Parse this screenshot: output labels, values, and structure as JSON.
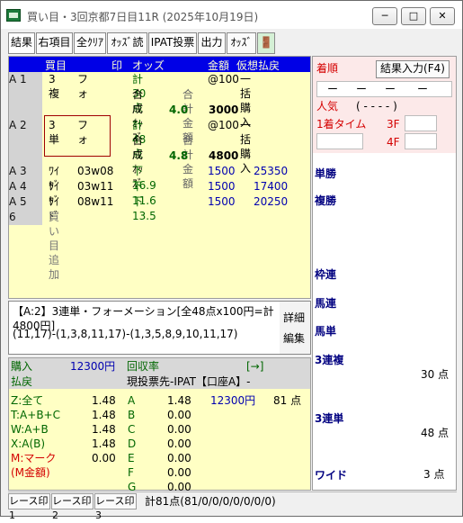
{
  "window": {
    "title": "買い目・3回京都7日目11R (2025年10月19日)",
    "controls": {
      "minimize": "─",
      "maximize": "□",
      "close": "✕"
    }
  },
  "toolbar": {
    "items": [
      "結果",
      "右項目",
      "全ｸﾘｱ",
      "ｵｯｽﾞ読",
      "IPAT投票",
      "出力",
      "ｵｯｽﾞ",
      "🚪"
    ]
  },
  "table": {
    "headers": [
      "買目",
      "印",
      "オッズ",
      "金額",
      "仮想払戻"
    ],
    "rows": [
      {
        "label": "A  1",
        "type": "3複",
        "sub": "フォ",
        "count": "計  30点",
        "unit": "@100",
        "buy": "一括購入"
      },
      {
        "label": "",
        "type": "",
        "sub": "",
        "count": "合成ｵｯｽﾞ",
        "unit": "合計金額",
        "buy": ""
      },
      {
        "label": "",
        "type": "",
        "sub": "",
        "count": "4.0",
        "unit": "3000",
        "buy": ""
      },
      {
        "label": "A  2",
        "type": "3単",
        "sub": "フォ",
        "count": "計  48点",
        "unit": "@100",
        "buy": "一括購入"
      },
      {
        "label": "",
        "type": "",
        "sub": "",
        "count": "合成ｵｯｽﾞ",
        "unit": "合計金額",
        "buy": ""
      },
      {
        "label": "",
        "type": "",
        "sub": "",
        "count": "4.8",
        "unit": "4800",
        "buy": ""
      },
      {
        "label": "A  3",
        "type": "ﾜｲﾄﾞ",
        "sub": "03w08",
        "count": "下   16.9",
        "unit": "1500",
        "buy": "25350"
      },
      {
        "label": "A  4",
        "type": "ﾜｲﾄﾞ",
        "sub": "03w11",
        "count": "下   11.6",
        "unit": "1500",
        "buy": "17400"
      },
      {
        "label": "A  5",
        "type": "ﾜｲﾄﾞ",
        "sub": "08w11",
        "count": "下   13.5",
        "unit": "1500",
        "buy": "20250"
      },
      {
        "label": "   6",
        "type": "買い目追加",
        "sub": "",
        "count": "",
        "unit": "",
        "buy": ""
      }
    ]
  },
  "info": {
    "line1": "【A:2】3連単・フォーメーション[全48点x100円=計4800円]",
    "line2": "(11,17)-(1,3,8,11,17)-(1,3,5,8,9,10,11,17)",
    "detail": "詳細",
    "edit": "編集"
  },
  "summary": {
    "buy_label": "購入",
    "buy_amount": "12300円",
    "return_label": "回収率",
    "arrow": "[→]",
    "refund_label": "払戻",
    "current": "現投票先-IPAT【口座A】-",
    "z": "Z:全て",
    "z_val": "1.48",
    "t": "T:A+B+C",
    "t_val": "1.48",
    "w": "W:A+B",
    "w_val": "1.48",
    "x": "X:A(B)",
    "x_val": "1.48",
    "m": "M:マーク",
    "m_val": "0.00",
    "m2": "(M金額)",
    "a": "A",
    "a_val": "1.48",
    "a_amt": "12300円",
    "a_cnt": "81 点",
    "b": "B",
    "b_val": "0.00",
    "c": "C",
    "c_val": "0.00",
    "d": "D",
    "d_val": "0.00",
    "e": "E",
    "e_val": "0.00",
    "f": "F",
    "f_val": "0.00",
    "g": "G",
    "g_val": "0.00"
  },
  "right": {
    "order": "着順",
    "result_button": "結果入力(F4)",
    "pop": "人気",
    "pop_vals": "( - - - - )",
    "time": "1着タイム",
    "f3": "3F",
    "f4": "4F",
    "dash1": "ー",
    "dash2": "ー",
    "dash3": "ー",
    "dash4": "ー",
    "win": "単勝",
    "place": "複勝",
    "bracket": "枠連",
    "quinella": "馬連",
    "exacta": "馬単",
    "trio": "3連複",
    "trio_count": "30 点",
    "trifecta": "3連単",
    "trifecta_count": "48 点",
    "wide": "ワイド",
    "wide_count": "3 点"
  },
  "status": {
    "tabs": [
      "レース印1",
      "レース印2",
      "レース印3"
    ],
    "summary": "計81点(81/0/0/0/0/0/0/0)"
  }
}
